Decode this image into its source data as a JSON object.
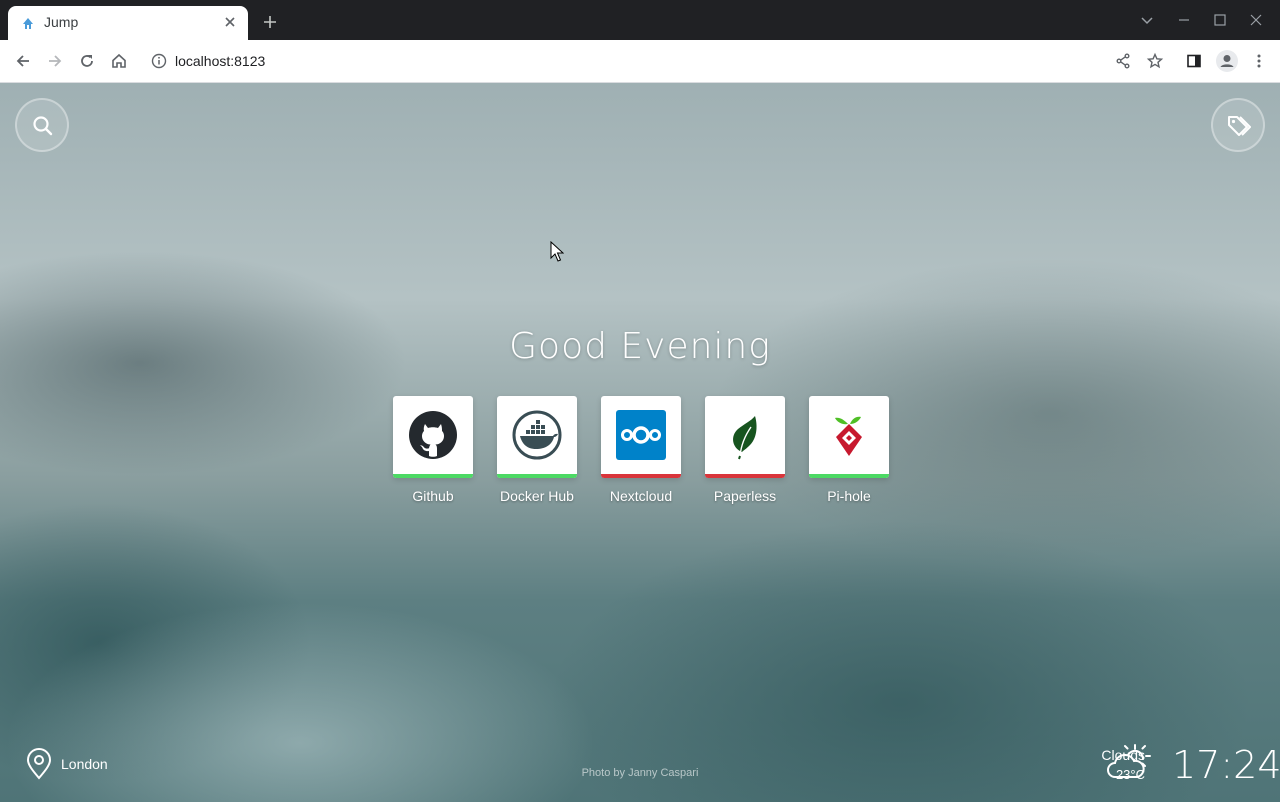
{
  "browser": {
    "tab_title": "Jump",
    "url": "localhost:8123"
  },
  "page": {
    "greeting": "Good Evening",
    "sites": [
      {
        "name": "Github",
        "status": "up",
        "status_color": "#4cd964",
        "icon": "github-icon"
      },
      {
        "name": "Docker Hub",
        "status": "up",
        "status_color": "#4cd964",
        "icon": "docker-icon"
      },
      {
        "name": "Nextcloud",
        "status": "down",
        "status_color": "#d9353b",
        "icon": "nextcloud-icon"
      },
      {
        "name": "Paperless",
        "status": "down",
        "status_color": "#d9353b",
        "icon": "paperless-leaf-icon"
      },
      {
        "name": "Pi-hole",
        "status": "up",
        "status_color": "#4cd964",
        "icon": "pihole-icon"
      }
    ],
    "location": "London",
    "photo_credit": "Photo by Janny Caspari",
    "weather": {
      "description": "Clouds",
      "temperature": "23°C",
      "icon": "partly-cloudy-icon"
    },
    "clock": "17:24"
  }
}
